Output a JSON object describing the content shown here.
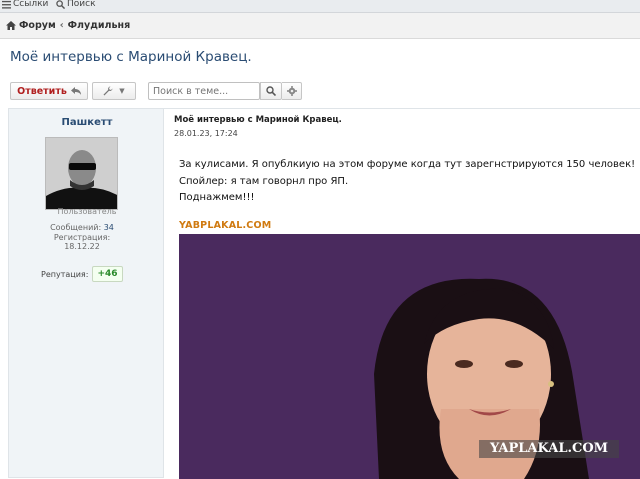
{
  "topbar": {
    "links_label": "Ссылки",
    "search_label": "Поиск"
  },
  "breadcrumb": {
    "forum": "Форум",
    "section": "Флудильня"
  },
  "page_title": "Моё интервью с Мариной Кравец.",
  "toolbar": {
    "reply_label": "Ответить",
    "search_placeholder": "Поиск в теме..."
  },
  "author": {
    "name": "Пашкетт",
    "role": "Пользователь",
    "messages_label": "Сообщений:",
    "messages": "34",
    "registration_label": "Регистрация:",
    "registration": "18.12.22",
    "reputation_label": "Репутация:",
    "reputation": "+46"
  },
  "post": {
    "title": "Моё интервью с Мариной Кравец.",
    "date": "28.01.23, 17:24",
    "lines": [
      "За кулисами. Я опублкиую на этом форуме когда тут зарегнстрируются 150 человек!",
      "Спойлер: я там говорнл про ЯП.",
      "Поднажмем!!!"
    ],
    "source_caption": "YABPLAKAL.COM",
    "watermark": "YAPLAKAL.COM"
  },
  "colors": {
    "link": "#2a4c73",
    "reply": "#b01e1e",
    "photo_bg": "#4a2a5e",
    "caption": "#d07a10"
  }
}
